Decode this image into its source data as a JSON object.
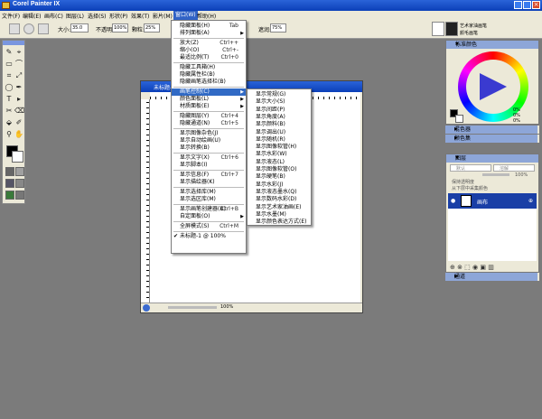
{
  "window": {
    "title": "Corel Painter IX"
  },
  "menubar": {
    "items": [
      "文件(F)",
      "编辑(E)",
      "画布(C)",
      "图层(L)",
      "选择(S)",
      "形状(P)",
      "效果(T)",
      "影片(M)",
      "窗口(W)",
      "帮助(H)"
    ]
  },
  "propbar": {
    "size_label": "大小:",
    "size_value": "35.0",
    "opacity_label": "不透明度:",
    "opacity_value": "100%",
    "grain_label": "颗粒:",
    "grain_value": "25%",
    "resat_label": "遮润:",
    "resat_value": "75%"
  },
  "brush": {
    "category": "艺术家油画笔",
    "variant": "颜毛画笔"
  },
  "document": {
    "title": "未标题-1",
    "zoom": "100%"
  },
  "window_menu": {
    "items": [
      {
        "label": "隐藏面板(H)",
        "shortcut": "Tab"
      },
      {
        "label": "排列面板(A)",
        "arrow": true
      },
      {
        "sep": true
      },
      {
        "label": "放大(Z)",
        "shortcut": "Ctrl++"
      },
      {
        "label": "缩小(O)",
        "shortcut": "Ctrl+-"
      },
      {
        "label": "最适比例(T)",
        "shortcut": "Ctrl+0"
      },
      {
        "sep": true
      },
      {
        "label": "隐藏工具箱(H)"
      },
      {
        "label": "隐藏属性栏(B)"
      },
      {
        "label": "隐藏画笔选择栏(B)"
      },
      {
        "sep": true
      },
      {
        "label": "画笔控制(C)",
        "arrow": true,
        "highlight": true
      },
      {
        "label": "颜色面板(L)",
        "arrow": true
      },
      {
        "label": "材质面板(E)",
        "arrow": true
      },
      {
        "sep": true
      },
      {
        "label": "隐藏图层(Y)",
        "shortcut": "Ctrl+4"
      },
      {
        "label": "隐藏通道(N)",
        "shortcut": "Ctrl+5"
      },
      {
        "sep": true
      },
      {
        "label": "显示图像杂色(J)"
      },
      {
        "label": "显示自动绘画(U)"
      },
      {
        "label": "显示转换(B)"
      },
      {
        "sep": true
      },
      {
        "label": "显示文字(X)",
        "shortcut": "Ctrl+6"
      },
      {
        "label": "显示脚本(I)"
      },
      {
        "sep": true
      },
      {
        "label": "显示信息(F)",
        "shortcut": "Ctrl+7"
      },
      {
        "label": "显示描绘器(K)"
      },
      {
        "sep": true
      },
      {
        "label": "显示选择库(M)"
      },
      {
        "label": "显示选区库(M)"
      },
      {
        "sep": true
      },
      {
        "label": "显示画笔创建器(B)",
        "shortcut": "Ctrl+B"
      },
      {
        "label": "自定面板(O)",
        "arrow": true
      },
      {
        "sep": true
      },
      {
        "label": "全屏模式(S)",
        "shortcut": "Ctrl+M"
      },
      {
        "sep": true
      },
      {
        "label": "未标题-1 @ 100%",
        "checked": true
      }
    ]
  },
  "brush_submenu": {
    "items": [
      "显示常规(G)",
      "显示大小(S)",
      "显示间距(P)",
      "显示角度(A)",
      "显示颜料(B)",
      "显示调出(U)",
      "显示随机(R)",
      "显示图像软管(H)",
      "显示水彩(W)",
      "显示液态(L)",
      "显示图像软管(O)",
      "显示硬笔(B)",
      "显示水彩(J)",
      "显示液态墨水(Q)",
      "显示数码水彩(D)",
      "显示艺术家油画(E)",
      "显示水墨(M)",
      "显示颜色表达方式(E)"
    ]
  },
  "color_panel": {
    "title": "标准颜色",
    "hue": "0%",
    "sat": "0%",
    "val": "0%"
  },
  "mixer_panel": {
    "title": "混色器"
  },
  "colorset_panel": {
    "title": "颜色集"
  },
  "layers_panel": {
    "title": "图层",
    "mode": "默认",
    "blend": "溶解",
    "opacity": "100%",
    "preserve": "保持透明度",
    "pick": "从下层中采集颜色",
    "layer_name": "画布"
  },
  "channels_panel": {
    "title": "通道"
  },
  "colors": {
    "titlebar": "#0b3fb8",
    "highlight": "#316ac5",
    "workspace": "#7b7b7b"
  }
}
